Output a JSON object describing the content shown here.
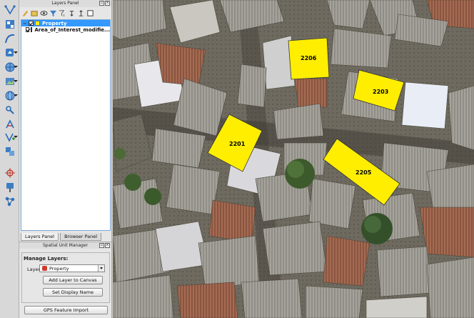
{
  "toolbar": {
    "tools": [
      {
        "icon": "digitize-line-icon"
      },
      {
        "icon": "grid-edit-icon"
      },
      {
        "icon": "curve-icon"
      },
      {
        "icon": "add-vector-layer-icon"
      },
      {
        "icon": "globe-layer-icon"
      },
      {
        "icon": "add-raster-icon"
      },
      {
        "icon": "globe-wms-icon"
      },
      {
        "icon": "node-tool-icon"
      },
      {
        "icon": "split-feature-icon"
      },
      {
        "icon": "vertex-add-icon"
      },
      {
        "icon": "merge-features-icon"
      },
      {
        "icon": "capture-point-icon"
      },
      {
        "icon": "gps-marker-icon"
      },
      {
        "icon": "network-icon"
      }
    ]
  },
  "layers_panel": {
    "title": "Layers Panel",
    "layers": [
      {
        "name": "Property",
        "selected": true,
        "color": "#ffee00"
      },
      {
        "name": "Area_of_Interest_modifie...",
        "selected": false,
        "color": "#2b2b2b"
      }
    ],
    "tabs": [
      "Layers Panel",
      "Browser Panel"
    ]
  },
  "spatial_unit_manager": {
    "title": "Spatial Unit Manager",
    "group_title": "Manage Layers:",
    "layer_label": "Layer",
    "layer_value": "Property",
    "add_button": "Add Layer to Canvas",
    "display_button": "Set Display Name",
    "gps_button": "GPS Feature Import"
  },
  "map": {
    "parcels": [
      {
        "label": "2206",
        "color": "#ffee00"
      },
      {
        "label": "2203",
        "color": "#ffee00"
      },
      {
        "label": "2201",
        "color": "#ffee00"
      },
      {
        "label": "2205",
        "color": "#ffee00"
      }
    ]
  }
}
